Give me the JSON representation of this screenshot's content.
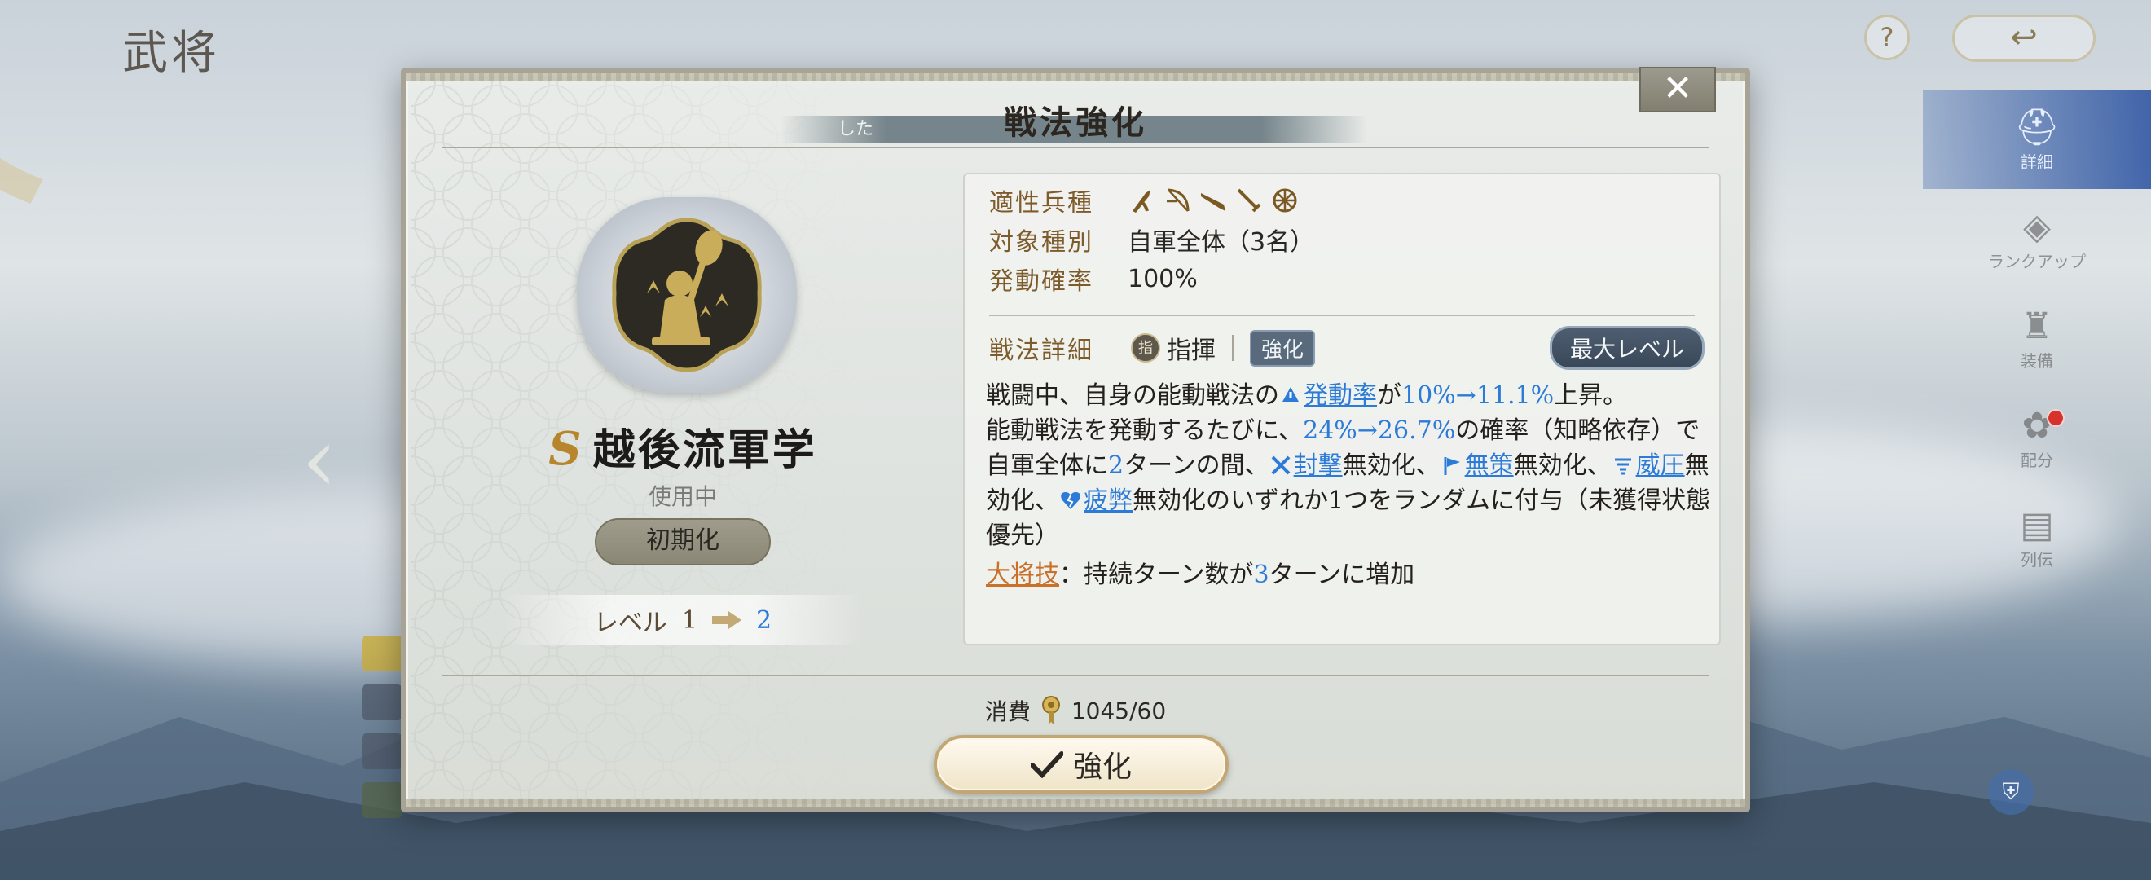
{
  "background": {
    "page_heading": "武将"
  },
  "top_right": {
    "help_glyph": "?",
    "back_glyph": "↩"
  },
  "side_menu": [
    {
      "icon": "helmet-icon",
      "glyph": "⛑",
      "label": "詳細",
      "active": true
    },
    {
      "icon": "eye-icon",
      "glyph": "◈",
      "label": "ランクアップ",
      "active": false
    },
    {
      "icon": "armor-icon",
      "glyph": "♜",
      "label": "装備",
      "active": false
    },
    {
      "icon": "gear-icon",
      "glyph": "✿",
      "label": "配分",
      "active": false,
      "badge": true
    },
    {
      "icon": "book-icon",
      "glyph": "▤",
      "label": "列伝",
      "active": false
    }
  ],
  "dialog": {
    "title": "戦法強化",
    "title_sub": "した",
    "close_glyph": "✕",
    "skill": {
      "rank": "S",
      "name": "越後流軍学",
      "status": "使用中",
      "reset_label": "初期化",
      "level_label": "レベル",
      "level_current": "1",
      "level_next": "2"
    },
    "attributes": [
      {
        "label": "適性兵種",
        "icons": [
          "spear-icon",
          "bow-icon",
          "gun-icon",
          "sword-icon",
          "wheel-icon"
        ]
      },
      {
        "label": "対象種別",
        "value": "自軍全体（3名）"
      },
      {
        "label": "発動確率",
        "value": "100%"
      }
    ],
    "detail": {
      "label": "戦法詳細",
      "command_badge": "指",
      "command_text": "指揮",
      "enhance_tag": "強化",
      "max_level_label": "最大レベル"
    },
    "description": {
      "p1": "戦闘中、自身の能動戦法の",
      "kw_rate": "発動率",
      "p2": "が",
      "rate_change": "10%→11.1%",
      "p3": "上昇。",
      "p4": "能動戦法を発動するたびに、",
      "prob_change": "24%→26.7%",
      "p5": "の確率（知略依存）で自軍全体に",
      "turns": "2",
      "p6": "ターンの間、",
      "kw_seal": "封撃",
      "p7": "無効化、",
      "kw_nostrategy": "無策",
      "p8": "無効化、",
      "kw_intimidate": "威圧",
      "p9": "無効化、",
      "kw_fatigue": "疲弊",
      "p10": "無効化のいずれか1つをランダムに付与（未獲得状態優先）"
    },
    "general_skill": {
      "label": "大将技",
      "p1": "：持続ターン数が",
      "turns": "3",
      "p2": "ターンに増加"
    },
    "cost": {
      "label": "消費",
      "value": "1045/60"
    },
    "enhance_button": "強化"
  },
  "colors": {
    "highlight_blue": "#2c7bd8",
    "label_brown": "#7d5b2b",
    "general_orange": "#c9702a",
    "rank_gold": "#b7862c"
  }
}
